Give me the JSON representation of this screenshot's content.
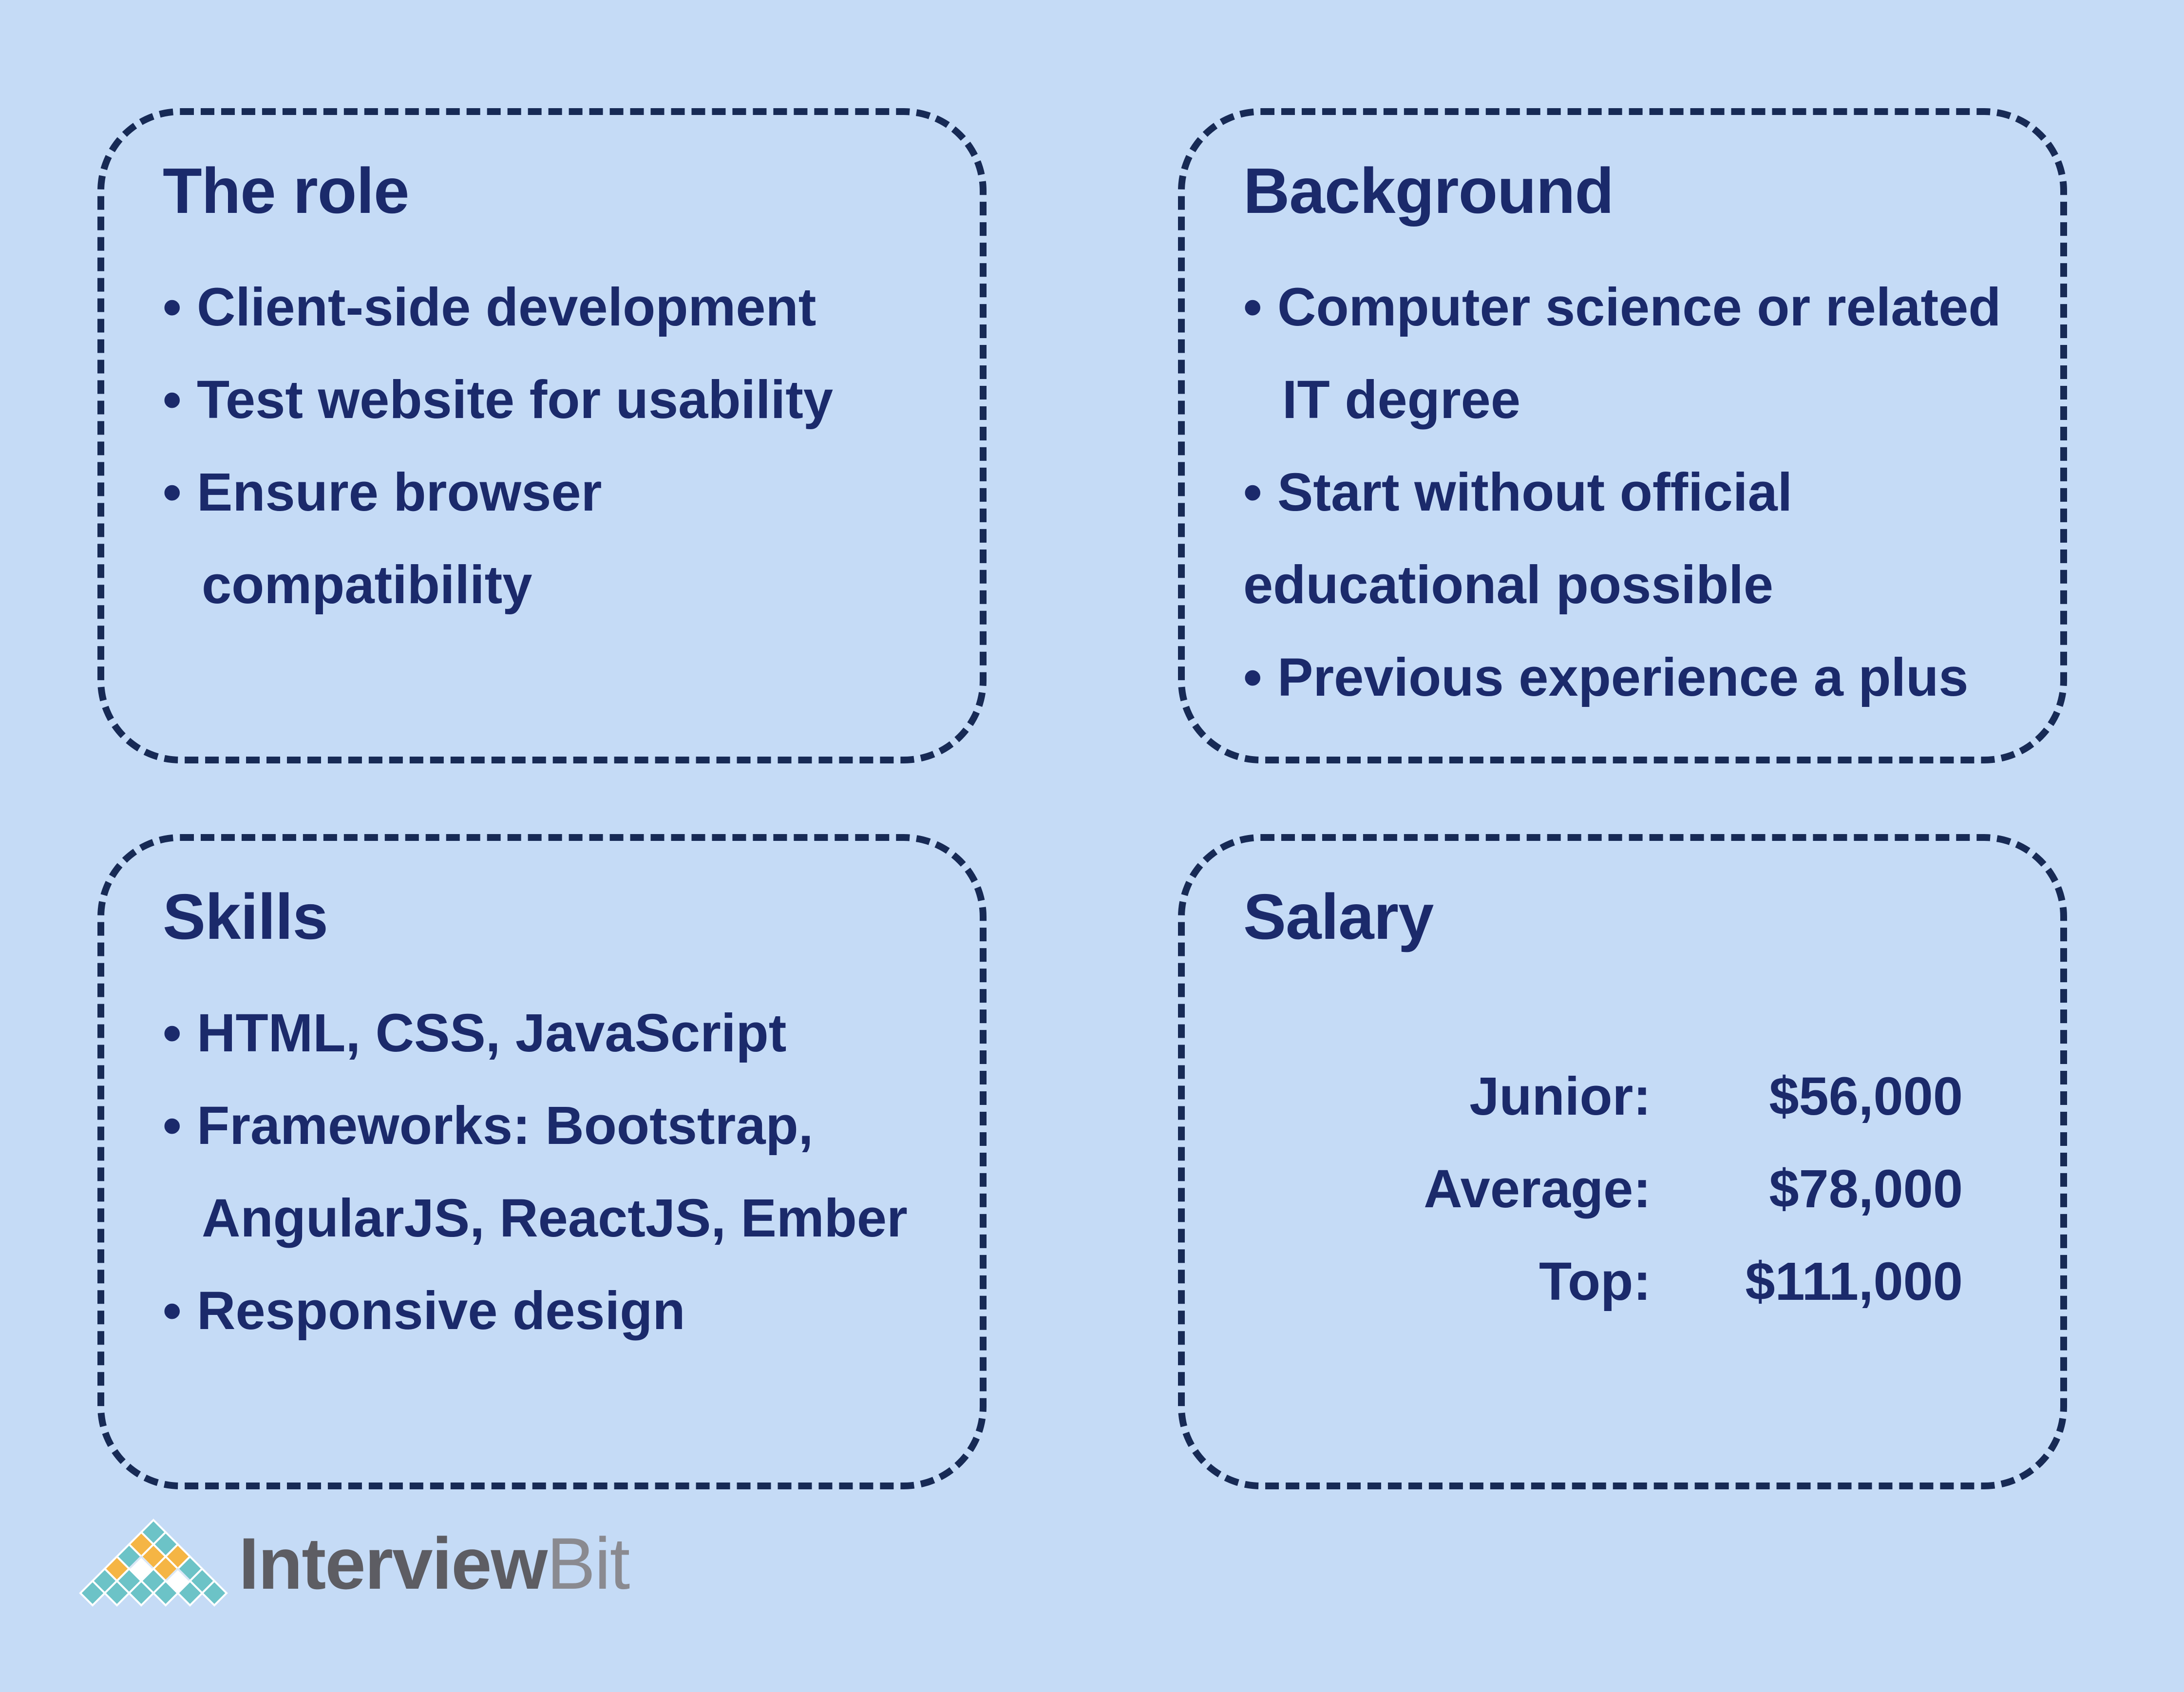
{
  "cards": {
    "role": {
      "title": "The role",
      "bullets": [
        {
          "text": "Client-side development"
        },
        {
          "text": "Test website for usability"
        },
        {
          "text": "Ensure browser",
          "continuation": "compatibility"
        }
      ]
    },
    "background": {
      "title": "Background",
      "bullets": [
        {
          "text": "Computer science or related",
          "continuation": "IT degree"
        },
        {
          "text": "Start without official",
          "continuation": "educational possible"
        },
        {
          "text": "Previous experience a plus"
        }
      ]
    },
    "skills": {
      "title": "Skills",
      "bullets": [
        {
          "text": "HTML, CSS, JavaScript"
        },
        {
          "text": "Frameworks: Bootstrap,",
          "continuation": "AngularJS, ReactJS, Ember"
        },
        {
          "text": "Responsive design"
        }
      ]
    },
    "salary": {
      "title": "Salary",
      "rows": [
        {
          "label": "Junior:",
          "value": "$56,000"
        },
        {
          "label": "Average:",
          "value": "$78,000"
        },
        {
          "label": "Top:",
          "value": "$111,000"
        }
      ]
    }
  },
  "bullet_symbol": "•",
  "logo": {
    "text_part1": "Interview",
    "text_part2": "Bit",
    "mark_icon": "interviewbit-diamond-grid-icon"
  },
  "colors": {
    "background": "#c5dbf6",
    "text": "#1b2a6b",
    "border": "#172a55",
    "logo_orange": "#f5b544",
    "logo_teal": "#6cc3c7",
    "logo_gray": "#5d5d63"
  }
}
